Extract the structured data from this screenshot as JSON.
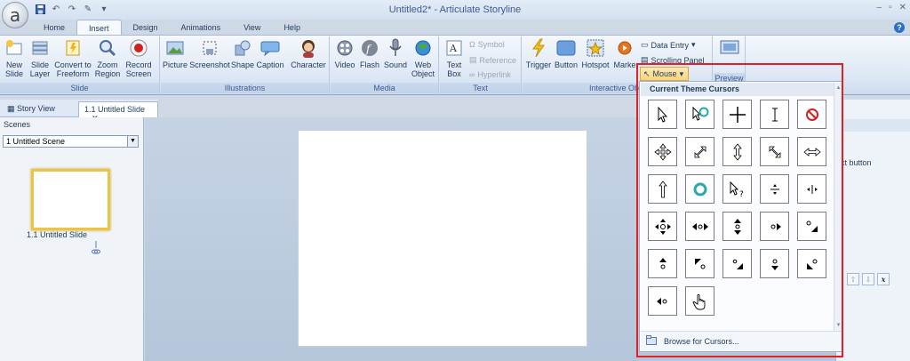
{
  "window": {
    "title": "Untitled2* - Articulate Storyline",
    "app_logo": "a"
  },
  "ribbon_tabs": [
    "Home",
    "Insert",
    "Design",
    "Animations",
    "View",
    "Help"
  ],
  "active_tab": "Insert",
  "groups": {
    "slide": {
      "label": "Slide",
      "buttons": [
        "New Slide",
        "Slide Layer",
        "Convert to Freeform",
        "Zoom Region",
        "Record Screen"
      ]
    },
    "illustrations": {
      "label": "Illustrations",
      "buttons": [
        "Picture",
        "Screenshot",
        "Shape",
        "Caption",
        "Character"
      ]
    },
    "media": {
      "label": "Media",
      "buttons": [
        "Video",
        "Flash",
        "Sound",
        "Web Object"
      ]
    },
    "text": {
      "label": "Text",
      "big_button": "Text Box",
      "small_buttons": [
        "Symbol",
        "Reference",
        "Hyperlink"
      ]
    },
    "interactive": {
      "label": "Interactive Obje",
      "buttons": [
        "Trigger",
        "Button",
        "Hotspot",
        "Marke"
      ],
      "small_buttons": [
        "Data Entry",
        "Scrolling Panel"
      ],
      "mouse_label": "Mouse"
    },
    "preview": {
      "label": "Preview"
    }
  },
  "left_panel": {
    "tabs": [
      "Story View",
      "1.1 Untitled Slide"
    ],
    "scenes_label": "Scenes",
    "scene_selected": "1 Untitled Scene",
    "slide_label": "1.1 Untitled Slide"
  },
  "right_panel": {
    "text": "xt button"
  },
  "mouse_dropdown": {
    "header": "Current Theme Cursors",
    "footer": "Browse for Cursors...",
    "cursors": [
      "arrow-cursor-icon",
      "arrow-busy-cursor-icon",
      "crosshair-cursor-icon",
      "ibeam-cursor-icon",
      "no-cursor-icon",
      "move-cursor-icon",
      "resize-nesw-cursor-icon",
      "resize-ns-cursor-icon",
      "resize-nwse-cursor-icon",
      "resize-ew-cursor-icon",
      "up-arrow-cursor-icon",
      "busy-ring-cursor-icon",
      "help-cursor-icon",
      "pan-ns-cursor-icon",
      "pan-ew-cursor-icon",
      "pan-all-cursor-icon",
      "pan-east-west-cursor-icon",
      "pan-north-south-cursor-icon",
      "pan-east-cursor-icon",
      "pan-southeast-cursor-icon",
      "pan-north-cursor-icon",
      "pan-northwest-cursor-icon",
      "pan-southeast-small-cursor-icon",
      "pan-south-cursor-icon",
      "pan-southwest-cursor-icon",
      "pan-west-cursor-icon",
      "hand-cursor-icon"
    ]
  },
  "colors": {
    "highlight_frame": "#e12128",
    "ribbon_text": "#1e395b",
    "thumb_border": "#e9c446"
  }
}
